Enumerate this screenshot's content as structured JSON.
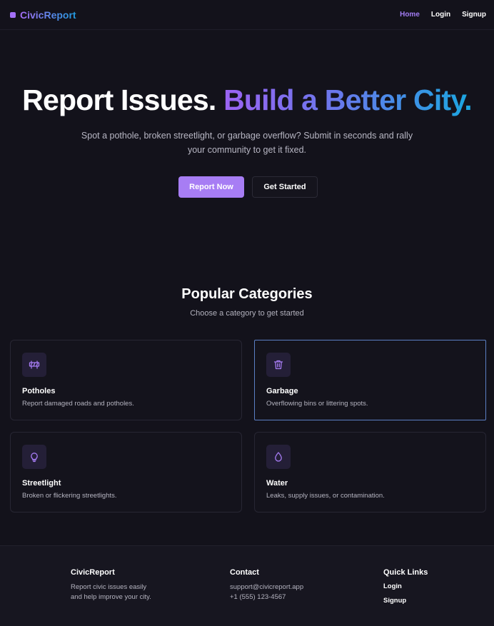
{
  "nav": {
    "brand": "CivicReport",
    "links": [
      {
        "label": "Home",
        "active": true
      },
      {
        "label": "Login",
        "active": false
      },
      {
        "label": "Signup",
        "active": false
      }
    ]
  },
  "hero": {
    "title_plain": "Report Issues.",
    "title_gradient": "Build a Better City.",
    "subtitle_line1": "Spot a pothole, broken streetlight, or garbage overflow? Submit in seconds and rally",
    "subtitle_line2": "your community to get it fixed.",
    "primary_button": "Report Now",
    "secondary_button": "Get Started"
  },
  "categories": {
    "title": "Popular Categories",
    "subtitle": "Choose a category to get started",
    "items": [
      {
        "title": "Potholes",
        "description": "Report damaged roads and potholes.",
        "icon": "road-barrier-icon"
      },
      {
        "title": "Garbage",
        "description": "Overflowing bins or littering spots.",
        "icon": "trash-icon",
        "selected": true
      },
      {
        "title": "Streetlight",
        "description": "Broken or flickering streetlights.",
        "icon": "lightbulb-icon"
      },
      {
        "title": "Water",
        "description": "Leaks, supply issues, or contamination.",
        "icon": "droplet-icon"
      }
    ]
  },
  "footer": {
    "brand": {
      "title": "CivicReport",
      "line1": "Report civic issues easily",
      "line2": "and help improve your city."
    },
    "contact": {
      "title": "Contact",
      "email": "support@civicreport.app",
      "phone": "+1 (555) 123-4567"
    },
    "quick_links": {
      "title": "Quick Links",
      "links": [
        "Login",
        "Signup"
      ]
    }
  },
  "colors": {
    "background": "#13121b",
    "accent": "#a77df4",
    "gradient_start": "#9b63f2",
    "gradient_end": "#1aa6e0",
    "selected_border": "#5b7fc4"
  }
}
